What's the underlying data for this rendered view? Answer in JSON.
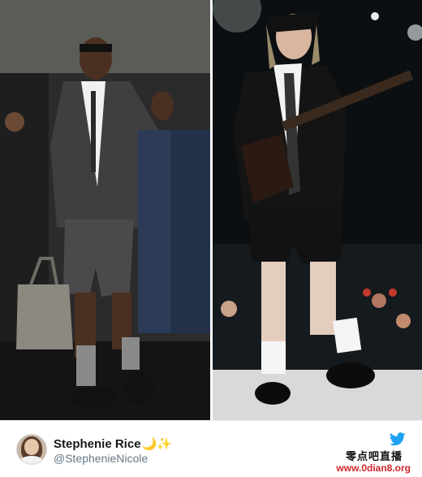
{
  "tweet": {
    "display_name": "Stephenie Rice",
    "name_emoji": "🌙✨",
    "handle": "@StephenieNicole"
  },
  "icons": {
    "brand": "twitter-bird-icon",
    "avatar": "profile-avatar"
  },
  "watermark": {
    "chinese": "零点吧直播",
    "url": "www.0dian8.org"
  },
  "colors": {
    "twitter_blue": "#1da1f2",
    "handle_gray": "#657786",
    "watermark_red": "#d0252b"
  }
}
